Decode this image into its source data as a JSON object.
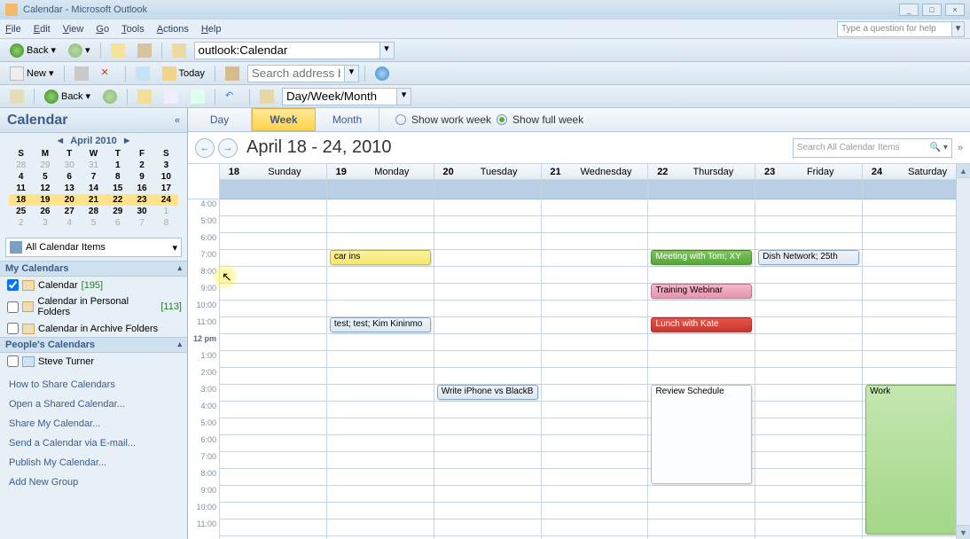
{
  "window": {
    "title": "Calendar - Microsoft Outlook"
  },
  "menu": {
    "file": "File",
    "edit": "Edit",
    "view": "View",
    "go": "Go",
    "tools": "Tools",
    "actions": "Actions",
    "help": "Help",
    "question_placeholder": "Type a question for help"
  },
  "toolbar1": {
    "back": "Back",
    "address": "outlook:Calendar"
  },
  "toolbar2": {
    "new": "New",
    "today": "Today",
    "search_placeholder": "Search address books"
  },
  "toolbar3": {
    "back": "Back",
    "viewmode": "Day/Week/Month"
  },
  "sidebar": {
    "title": "Calendar",
    "minical": {
      "month": "April 2010",
      "dows": [
        "S",
        "M",
        "T",
        "W",
        "T",
        "F",
        "S"
      ],
      "rows": [
        {
          "cells": [
            "28",
            "29",
            "30",
            "31",
            "1",
            "2",
            "3"
          ],
          "other": [
            0,
            1,
            2,
            3
          ]
        },
        {
          "cells": [
            "4",
            "5",
            "6",
            "7",
            "8",
            "9",
            "10"
          ]
        },
        {
          "cells": [
            "11",
            "12",
            "13",
            "14",
            "15",
            "16",
            "17"
          ]
        },
        {
          "cells": [
            "18",
            "19",
            "20",
            "21",
            "22",
            "23",
            "24"
          ],
          "selected": true
        },
        {
          "cells": [
            "25",
            "26",
            "27",
            "28",
            "29",
            "30",
            "1"
          ],
          "other": [
            6
          ]
        },
        {
          "cells": [
            "2",
            "3",
            "4",
            "5",
            "6",
            "7",
            "8"
          ],
          "other": [
            0,
            1,
            2,
            3,
            4,
            5,
            6
          ]
        }
      ]
    },
    "combo": "All Calendar Items",
    "sections": {
      "my": "My Calendars",
      "people": "People's Calendars"
    },
    "calendars": [
      {
        "label": "Calendar",
        "count": "[195]",
        "checked": true
      },
      {
        "label": "Calendar in Personal Folders",
        "count": "[113]",
        "checked": false
      },
      {
        "label": "Calendar in Archive Folders",
        "count": "",
        "checked": false
      }
    ],
    "people": [
      {
        "label": "Steve Turner",
        "checked": false
      }
    ],
    "links": [
      "How to Share Calendars",
      "Open a Shared Calendar...",
      "Share My Calendar...",
      "Send a Calendar via E-mail...",
      "Publish My Calendar...",
      "Add New Group"
    ]
  },
  "content": {
    "tabs": {
      "day": "Day",
      "week": "Week",
      "month": "Month"
    },
    "workweek": "Show work week",
    "fullweek": "Show full week",
    "range": "April 18 - 24, 2010",
    "search_placeholder": "Search All Calendar Items",
    "days": [
      {
        "num": "18",
        "name": "Sunday"
      },
      {
        "num": "19",
        "name": "Monday"
      },
      {
        "num": "20",
        "name": "Tuesday"
      },
      {
        "num": "21",
        "name": "Wednesday"
      },
      {
        "num": "22",
        "name": "Thursday"
      },
      {
        "num": "23",
        "name": "Friday"
      },
      {
        "num": "24",
        "name": "Saturday"
      }
    ],
    "hours": [
      "4:00",
      "5:00",
      "6:00",
      "7:00",
      "8:00",
      "9:00",
      "10:00",
      "11:00",
      "12 pm",
      "1:00",
      "2:00",
      "3:00",
      "4:00",
      "5:00",
      "6:00",
      "7:00",
      "8:00",
      "9:00",
      "10:00",
      "11:00"
    ],
    "appointments": [
      {
        "day": 1,
        "start": 7,
        "end": 8,
        "label": "car ins",
        "style": "yellow"
      },
      {
        "day": 1,
        "start": 11,
        "end": 12,
        "label": "test; test; Kim Kininmo",
        "style": "blueish"
      },
      {
        "day": 2,
        "start": 15,
        "end": 16,
        "label": "Write iPhone vs BlackB",
        "style": "blueish"
      },
      {
        "day": 4,
        "start": 7,
        "end": 8,
        "label": "Meeting with Tom; XY",
        "style": "green"
      },
      {
        "day": 4,
        "start": 9,
        "end": 10,
        "label": "Training Webinar",
        "style": "pink"
      },
      {
        "day": 4,
        "start": 11,
        "end": 12,
        "label": "Lunch with Kate",
        "style": "red"
      },
      {
        "day": 4,
        "start": 15,
        "end": 21,
        "label": "Review Schedule",
        "style": "white"
      },
      {
        "day": 5,
        "start": 7,
        "end": 8,
        "label": "Dish Network; 25th",
        "style": "blueish"
      },
      {
        "day": 6,
        "start": 15,
        "end": 24,
        "label": "Work",
        "style": "lgreen"
      }
    ]
  }
}
